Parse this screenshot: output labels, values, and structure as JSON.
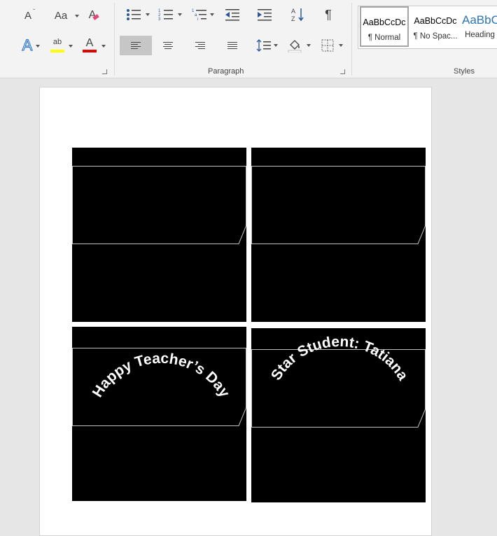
{
  "ribbon": {
    "font_buttons": {
      "shrink_font": "A",
      "change_case": "Aa",
      "clear_formatting": "A",
      "text_effects": "A",
      "highlight": "ab",
      "font_color": "A"
    },
    "paragraph_group_label": "Paragraph",
    "styles_group_label": "Styles",
    "highlight_color": "#ffff00",
    "font_color": "#e00000",
    "styles": [
      {
        "sample": "AaBbCcDc",
        "name": "¶ Normal",
        "selected": true
      },
      {
        "sample": "AaBbCcDc",
        "name": "¶ No Spac...",
        "selected": false
      },
      {
        "sample": "AaBbC",
        "name": "Heading",
        "selected": false
      }
    ]
  },
  "document": {
    "labels": [
      {
        "curved_text": ""
      },
      {
        "curved_text": ""
      },
      {
        "curved_text": "Happy Teacher’s Day"
      },
      {
        "curved_text": "Star Student: Tatiana"
      }
    ]
  }
}
